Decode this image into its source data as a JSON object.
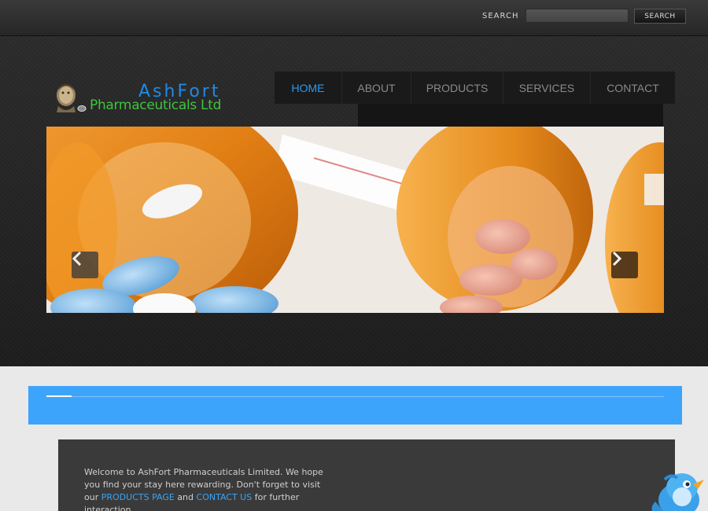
{
  "search": {
    "label": "SEARCH",
    "placeholder": "",
    "button_label": "SEARCH"
  },
  "logo": {
    "line1": "AshFort",
    "line2": "Pharmaceuticals Ltd"
  },
  "nav": {
    "items": [
      {
        "label": "HOME",
        "active": true
      },
      {
        "label": "ABOUT",
        "active": false
      },
      {
        "label": "PRODUCTS",
        "active": false
      },
      {
        "label": "SERVICES",
        "active": false
      },
      {
        "label": "CONTACT",
        "active": false
      }
    ]
  },
  "slider": {
    "prev_icon": "chevron-left-icon",
    "next_icon": "chevron-right-icon"
  },
  "welcome": {
    "line1": "Welcome to AshFort Pharmaceuticals Limited. We hope you find your stay here rewarding. Don't forget to visit our",
    "products_link": "PRODUCTS PAGE",
    "and": "and",
    "contact_link": "CONTACT US",
    "tail": "for further interaction."
  },
  "colors": {
    "accent_blue": "#3da4fb",
    "nav_active": "#2b9bf0",
    "logo_green": "#3ec43e",
    "logo_blue": "#1e8ae6"
  },
  "icons": {
    "social": "twitter-bird-icon"
  }
}
